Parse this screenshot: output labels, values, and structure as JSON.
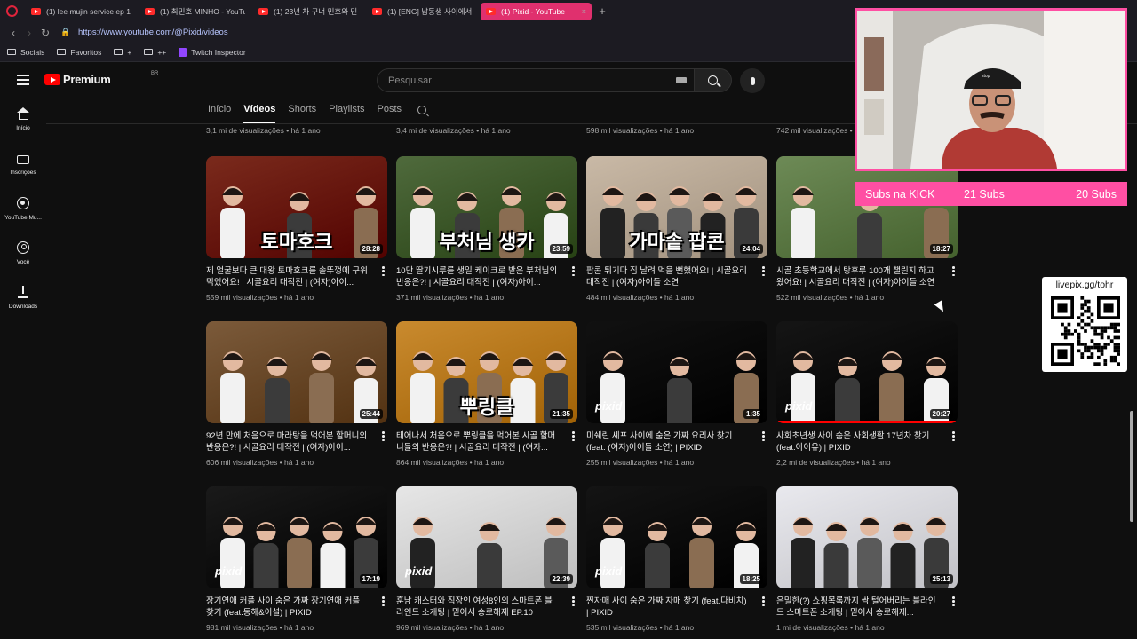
{
  "browser": {
    "tabs": [
      {
        "label": "(1) lee mujin service ep 1?",
        "active": false
      },
      {
        "label": "(1) 최민호 MINHO - YouTu",
        "active": false
      },
      {
        "label": "(1) 23년 차 구너 민호와 민",
        "active": false
      },
      {
        "label": "(1) [ENG] 남동생 사이에서",
        "active": false
      },
      {
        "label": "(1) Pixid - YouTube",
        "active": true
      }
    ],
    "url": "https://www.youtube.com/@Pixid/videos",
    "bookmarks": [
      {
        "label": "Sociais",
        "icon": "folder-icon"
      },
      {
        "label": "Favoritos",
        "icon": "folder-icon"
      },
      {
        "label": "+",
        "icon": "folder-icon"
      },
      {
        "label": "++",
        "icon": "folder-icon"
      },
      {
        "label": "Twitch Inspector",
        "icon": "twitch-icon"
      }
    ]
  },
  "header": {
    "logo_text": "Premium",
    "logo_region": "BR",
    "search_placeholder": "Pesquisar"
  },
  "sidebar": {
    "items": [
      {
        "label": "Início",
        "icon": "home-icon"
      },
      {
        "label": "Inscrições",
        "icon": "subscriptions-icon"
      },
      {
        "label": "YouTube Mu...",
        "icon": "music-icon"
      },
      {
        "label": "Você",
        "icon": "you-icon"
      },
      {
        "label": "Downloads",
        "icon": "download-icon"
      }
    ]
  },
  "channel_tabs": [
    "Início",
    "Vídeos",
    "Shorts",
    "Playlists",
    "Posts"
  ],
  "top_row_meta": [
    "3,1 mi de visualizações • há 1 ano",
    "3,4 mi de visualizações • há 1 ano",
    "598 mil visualizações • há 1 ano",
    "742 mil visualizações • há 1 ano"
  ],
  "videos": [
    {
      "title": "제 얼굴보다 큰 대왕 토마호크를 솥뚜껑에 구워 먹었어요! | 시골요리 대작전 | (여자)아이...",
      "meta": "559 mil visualizações • há 1 ano",
      "duration": "28:28",
      "overlay": "토마호크",
      "bg": "#7a2a1c"
    },
    {
      "title": "10단 딸기시루를 생일 케이크로 받은 부처님의 반응은?! | 시골요리 대작전 | (여자)아이...",
      "meta": "371 mil visualizações • há 1 ano",
      "duration": "23:59",
      "overlay": "부처님 생카",
      "bg": "#4f6a3c"
    },
    {
      "title": "팝콘 튀기다 집 날려 먹을 뻔했어요! | 시골요리 대작전 | (여자)아이들 소연",
      "meta": "484 mil visualizações • há 1 ano",
      "duration": "24:04",
      "overlay": "가마솥 팝콘",
      "bg": "#c9b9a6"
    },
    {
      "title": "시골 초등학교에서 탕후루 100개 챌린지 하고 왔어요! | 시골요리 대작전 | (여자)아이들 소연",
      "meta": "522 mil visualizações • há 1 ano",
      "duration": "18:27",
      "overlay": "",
      "bg": "#6d8a56"
    },
    {
      "title": "92년 만에 처음으로 마라탕을 먹어본 할머니의 반응은?! | 시골요리 대작전 | (여자)아이...",
      "meta": "606 mil visualizações • há 1 ano",
      "duration": "25:44",
      "overlay": "",
      "bg": "#7b5a3a"
    },
    {
      "title": "태어나서 처음으로 뿌링클을 먹어본 시골 할머니들의 반응은?! | 시골요리 대작전 | (여자...",
      "meta": "864 mil visualizações • há 1 ano",
      "duration": "21:35",
      "overlay": "뿌링클",
      "bg": "#c98a2e"
    },
    {
      "title": "미쉐린 셰프 사이에 숨은 가짜 요리사 찾기 (feat. (여자)아이들 소연) | PIXID",
      "meta": "255 mil visualizações • há 1 ano",
      "duration": "1:35",
      "overlay": "",
      "bg": "#111111"
    },
    {
      "title": "사회초년생 사이 숨은 사회생활 17년차 찾기 (feat.아이유) | PIXID",
      "meta": "2,2 mi de visualizações • há 1 ano",
      "duration": "20:27",
      "overlay": "",
      "bg": "#151515"
    },
    {
      "title": "장기연애 커플 사이 숨은 가짜 장기연애 커플 찾기 (feat.동해&이설) | PIXID",
      "meta": "981 mil visualizações • há 1 ano",
      "duration": "17:19",
      "overlay": "",
      "bg": "#1a1a1a"
    },
    {
      "title": "훈남 캐스터와 직장인 여성8인의 스마트폰 블라인드 소개팅 | 믿어서 송로해제 EP.10",
      "meta": "969 mil visualizações • há 1 ano",
      "duration": "22:39",
      "overlay": "",
      "bg": "#e6e6e6"
    },
    {
      "title": "찐자매 사이 숨은 가짜 자매 찾기 (feat.다비치) | PIXID",
      "meta": "535 mil visualizações • há 1 ano",
      "duration": "18:25",
      "overlay": "",
      "bg": "#141414"
    },
    {
      "title": "은밀한(?) 쇼핑목록까지 싹 털어버리는 블라인드 스마트폰 소개팅 | 믿어서 송로해제...",
      "meta": "1 mi de visualizações • há 1 ano",
      "duration": "25:13",
      "overlay": "",
      "bg": "#e9e9ee"
    }
  ],
  "stream_overlay": {
    "subs_label": "Subs na KICK",
    "subs_a": "21 Subs",
    "subs_b": "20 Subs",
    "qr_label": "livepix.gg/tohr"
  }
}
